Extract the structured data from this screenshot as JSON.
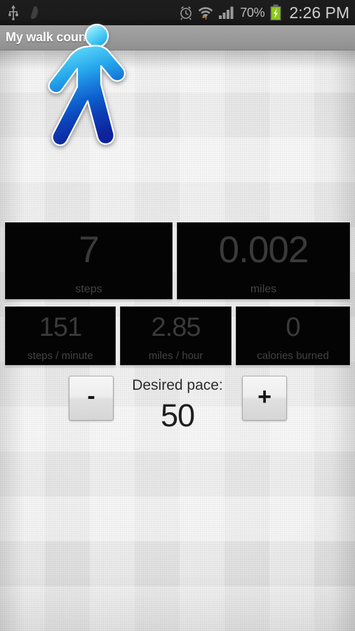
{
  "status_bar": {
    "icons_left": [
      "usb-icon",
      "footprint-icon"
    ],
    "icons_right": [
      "alarm-clock-icon",
      "wifi-icon",
      "cellular-signal-icon",
      "battery-charging-icon"
    ],
    "battery_percent": "70%",
    "time": "2:26 PM",
    "background_color": "#1b1b1b",
    "text_color": "#cfcfcf"
  },
  "title_bar": {
    "title": "My walk counter",
    "background_color": "#9c9c9c",
    "text_color": "#ffffff"
  },
  "hero": {
    "icon": "walking-person-icon",
    "color_top": "#5fd4f5",
    "color_bottom": "#0a2a9e"
  },
  "stats": {
    "primary": [
      {
        "value": "7",
        "label": "steps",
        "name": "steps"
      },
      {
        "value": "0.002",
        "label": "miles",
        "name": "miles"
      }
    ],
    "secondary": [
      {
        "value": "151",
        "label": "steps / minute",
        "name": "steps-per-minute"
      },
      {
        "value": "2.85",
        "label": "miles / hour",
        "name": "miles-per-hour"
      },
      {
        "value": "0",
        "label": "calories burned",
        "name": "calories-burned"
      }
    ],
    "panel_background": "#040404",
    "value_color": "#3a3a3a",
    "label_color": "#434343"
  },
  "pace": {
    "label": "Desired pace:",
    "value": "50",
    "decrement_label": "-",
    "increment_label": "+"
  }
}
